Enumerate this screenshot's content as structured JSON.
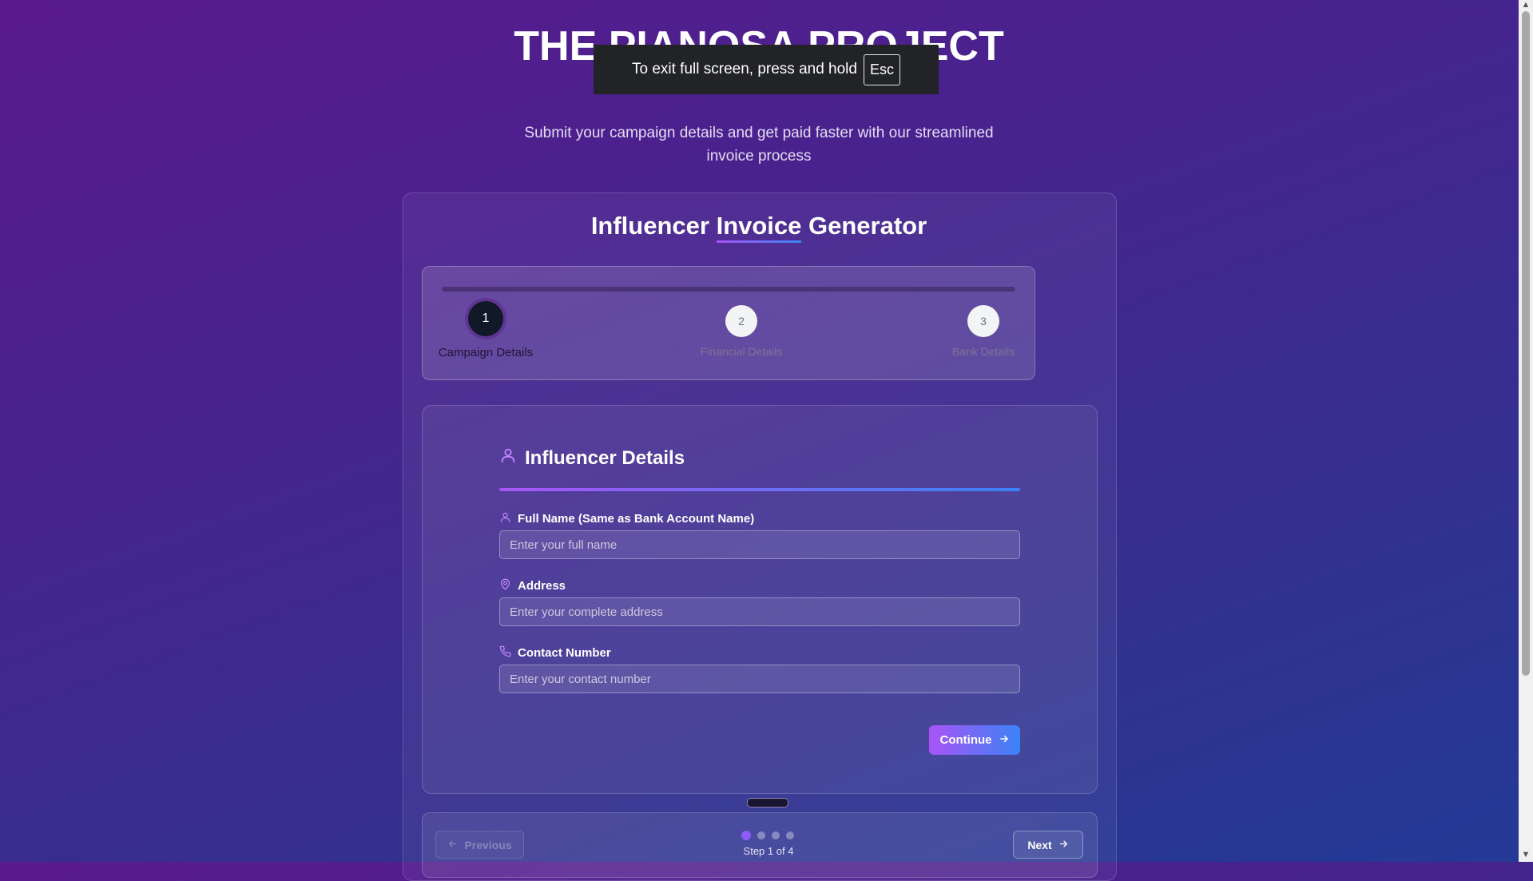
{
  "site": {
    "title": "THE PIANOSA PROJECT",
    "tagline_partial": "",
    "intro": "Submit your campaign details and get paid faster with our streamlined invoice process"
  },
  "fullscreen_toast": {
    "text": "To exit full screen, press and hold",
    "key": "Esc"
  },
  "card": {
    "title_pre": "Influencer ",
    "title_highlight": "Invoice",
    "title_post": " Generator"
  },
  "stepper": {
    "progress": 0,
    "steps": [
      {
        "number": "1",
        "label": "Campaign Details",
        "state": "active"
      },
      {
        "number": "2",
        "label": "Financial Details",
        "state": "idle"
      },
      {
        "number": "3",
        "label": "Bank Details",
        "state": "idle"
      }
    ]
  },
  "form": {
    "section_title": "Influencer Details",
    "section_icon": "user-icon",
    "fields": [
      {
        "label": "Full Name (Same as Bank Account Name)",
        "icon": "user-icon",
        "placeholder": "Enter your full name",
        "value": ""
      },
      {
        "label": "Address",
        "icon": "map-pin-icon",
        "placeholder": "Enter your complete address",
        "value": ""
      },
      {
        "label": "Contact Number",
        "icon": "phone-icon",
        "placeholder": "Enter your contact number",
        "value": ""
      }
    ],
    "continue_label": "Continue"
  },
  "pager": {
    "previous_label": "Previous",
    "next_label": "Next",
    "step_text": "Step 1 of 4",
    "current": 1,
    "total": 4
  },
  "colors": {
    "accent_start": "#a855f7",
    "accent_end": "#3b82f6",
    "title_yellow": "#f2c94c"
  }
}
